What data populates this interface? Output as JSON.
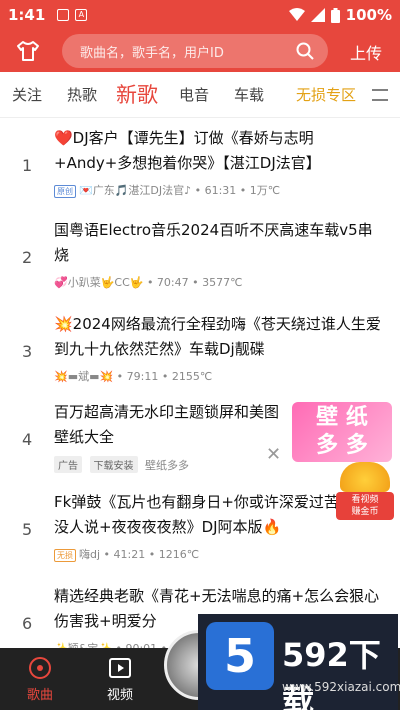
{
  "status_bar": {
    "time": "1:41",
    "battery": "100%"
  },
  "header": {
    "search_placeholder": "歌曲名，歌手名，用户ID",
    "upload_label": "上传"
  },
  "tabs": [
    "关注",
    "热歌",
    "新歌",
    "电音",
    "车载",
    "无损专区"
  ],
  "active_tab": "新歌",
  "songs": [
    {
      "rank": "1",
      "title": "❤️DJ客户【谭先生】订做《春娇与志明+Andy+多想抱着你哭》【湛江DJ法官】",
      "tag": "原创",
      "meta": "💌广东🎵湛江DJ法官♪ • 61:31 • 1万℃"
    },
    {
      "rank": "2",
      "title": "国粤语Electro音乐2024百听不厌高速车载v5串烧",
      "meta": "💞小趴菜🤟CC🤟 • 70:47 • 3577℃"
    },
    {
      "rank": "3",
      "title": "💥2024网络最流行全程劲嗨《苍天绕过谁人生爱到九十九依然茫然》车载Dj靓碟",
      "meta": "💥▬斌▬💥 • 79:11 • 2155℃"
    },
    {
      "rank": "4",
      "title": "百万超高清无水印主题锁屏和美图壁纸大全",
      "ad_label": "广告",
      "ad_action": "下载安装",
      "ad_source": "壁纸多多",
      "ad_banner_text": "壁 纸\n多 多"
    },
    {
      "rank": "5",
      "title": "Fk弹鼓《瓦片也有翻身日+你或许深爱过苦没人说+夜夜夜夜熬》DJ阿本版🔥",
      "tag": "无损",
      "meta": "嗨dj • 41:21 • 1216℃"
    },
    {
      "rank": "6",
      "title": "精选经典老歌《青花+无法喘息的痛+怎么会狠心伤害我+明爱分",
      "meta": "✨颖&宝✨ • 90:01 • 1"
    }
  ],
  "coin_widget": {
    "line1": "看视频",
    "line2": "赚金币"
  },
  "bottom_nav": [
    {
      "label": "歌曲",
      "icon": "music-disc-icon"
    },
    {
      "label": "视频",
      "icon": "video-icon"
    }
  ],
  "watermark": {
    "logo": "5",
    "title": "592下载",
    "url": "www.592xiazai.com"
  },
  "colors": {
    "brand": "#e7473d",
    "gold_tab": "#e3a115"
  }
}
